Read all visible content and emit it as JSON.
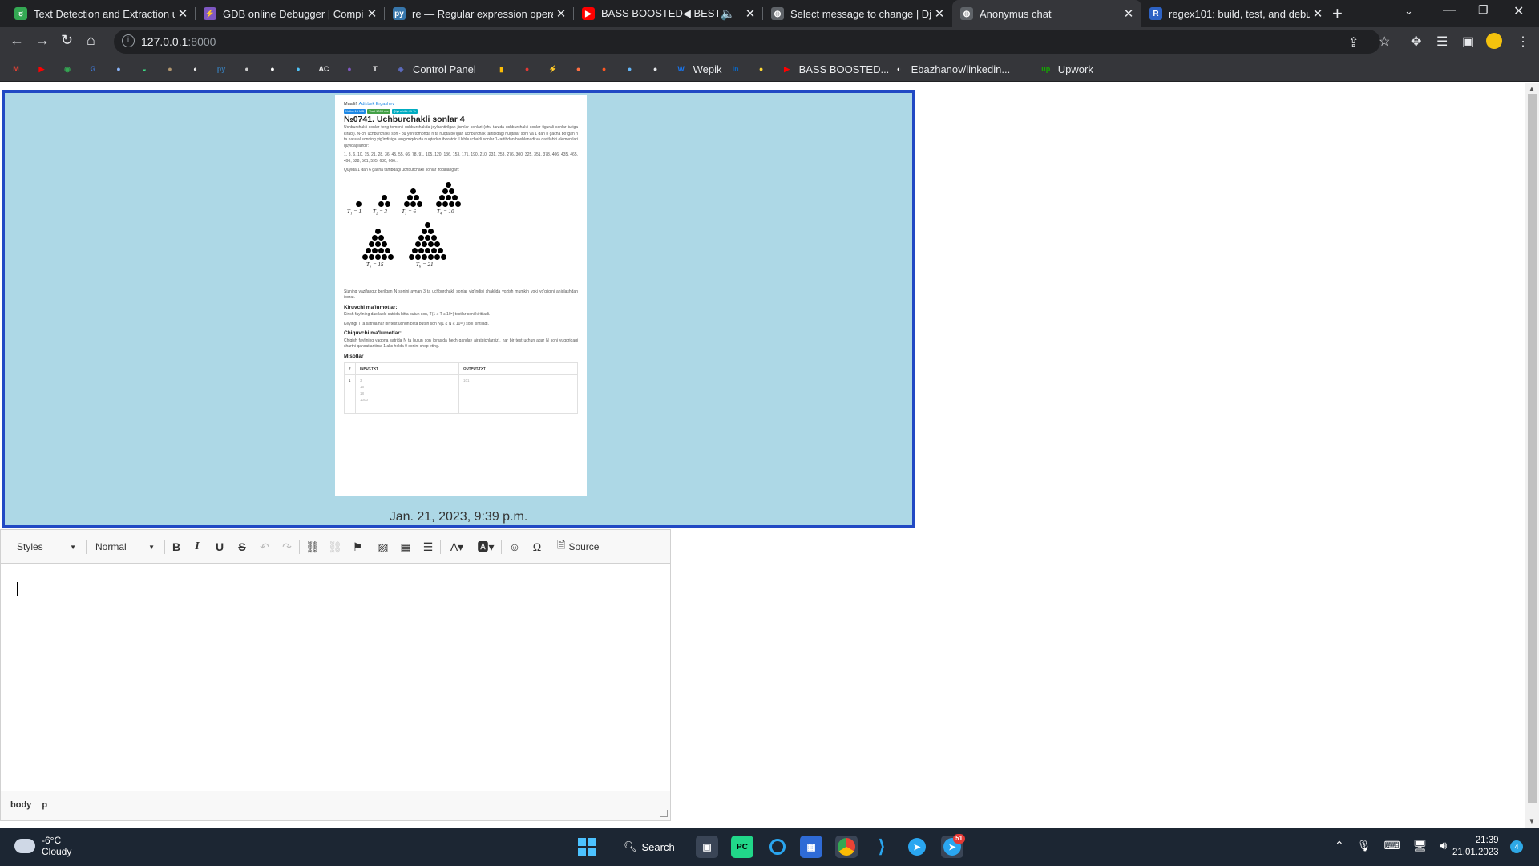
{
  "browser": {
    "tabs": [
      {
        "title": "Text Detection and Extraction us",
        "icon": "ocr-icon",
        "color": "#34a853"
      },
      {
        "title": "GDB online Debugger | Compile",
        "icon": "gdb-icon",
        "color": "#7e57c2"
      },
      {
        "title": "re — Regular expression operati",
        "icon": "python-icon",
        "color": "#3776ab"
      },
      {
        "title": "BASS BOOSTED◀ BEST",
        "icon": "youtube-icon",
        "color": "#ff0000"
      },
      {
        "title": "Select message to change | Djan",
        "icon": "globe-icon",
        "color": "#5f6368"
      },
      {
        "title": "Anonymus chat",
        "icon": "globe-icon",
        "color": "#5f6368"
      },
      {
        "title": "regex101: build, test, and debug",
        "icon": "regex101-icon",
        "color": "#2d62c4"
      }
    ],
    "url_host": "127.0.0.1",
    "url_port": ":8000",
    "bookmarks": [
      {
        "label": "",
        "icon": "gmail-icon",
        "color": "#ea4335"
      },
      {
        "label": "",
        "icon": "youtube-icon",
        "color": "#ff0000"
      },
      {
        "label": "",
        "icon": "maps-icon",
        "color": "#34a853"
      },
      {
        "label": "",
        "icon": "translate-icon",
        "color": "#4285f4"
      },
      {
        "label": "",
        "icon": "bookmark-icon",
        "color": "#8ab4f8"
      },
      {
        "label": "",
        "icon": "android-icon",
        "color": "#3ddc84"
      },
      {
        "label": "",
        "icon": "bookmark-icon",
        "color": "#b0956e"
      },
      {
        "label": "",
        "icon": "github-icon",
        "color": "#ffffff"
      },
      {
        "label": "",
        "icon": "python-icon",
        "color": "#3776ab"
      },
      {
        "label": "",
        "icon": "bookmark-icon",
        "color": "#cccccc"
      },
      {
        "label": "",
        "icon": "bookmark-icon",
        "color": "#ffffff"
      },
      {
        "label": "",
        "icon": "bookmark-icon",
        "color": "#4fc3f7"
      },
      {
        "label": "",
        "icon": "atcoder-icon",
        "color": "#eeeeee"
      },
      {
        "label": "",
        "icon": "bookmark-icon",
        "color": "#7e57c2"
      },
      {
        "label": "",
        "icon": "typora-icon",
        "color": "#ffffff"
      },
      {
        "label": "Control Panel",
        "icon": "control-panel-icon",
        "color": "#5c6bc0"
      },
      {
        "label": "",
        "icon": "chart-icon",
        "color": "#fbbc05"
      },
      {
        "label": "",
        "icon": "bookmark-icon",
        "color": "#e53935"
      },
      {
        "label": "",
        "icon": "gdb-icon",
        "color": "#7e57c2"
      },
      {
        "label": "",
        "icon": "bookmark-icon",
        "color": "#ff7043"
      },
      {
        "label": "",
        "icon": "bookmark-icon",
        "color": "#ff5722"
      },
      {
        "label": "",
        "icon": "bookmark-icon",
        "color": "#64b5f6"
      },
      {
        "label": "",
        "icon": "bookmark-icon",
        "color": "#e8eaed"
      },
      {
        "label": "Wepik",
        "icon": "wepik-icon",
        "color": "#1a73e8"
      },
      {
        "label": "",
        "icon": "linkedin-icon",
        "color": "#0a66c2"
      },
      {
        "label": "",
        "icon": "bookmark-icon",
        "color": "#fdd835"
      },
      {
        "label": "BASS BOOSTED...",
        "icon": "youtube-icon",
        "color": "#ff0000"
      },
      {
        "label": "Ebazhanov/linkedin...",
        "icon": "github-icon",
        "color": "#ffffff"
      },
      {
        "label": "Upwork",
        "icon": "upwork-icon",
        "color": "#14a800"
      }
    ]
  },
  "preview": {
    "author_label": "Muallif:",
    "author_name": "Adizbek Ergashev",
    "badges": [
      {
        "text": "Xotira 16 MB",
        "color": "#1e88e5"
      },
      {
        "text": "Vaqt 1000 ms",
        "color": "#43a047"
      },
      {
        "text": "Qiyinchilik 41 %",
        "color": "#00acc1"
      }
    ],
    "title": "№0741. Uchburchakli sonlar 4",
    "intro": "Uchburchakli sonlar teng tomonli uchburchakda joylashtirilgan jismlar sonlari (shu tarzda uchburchakli sonlar figurali sonlar turiga kiradi). N-chi uchburchakli son - bu yon tomonda n ta nuqta bo'lgan uchburchak tartibidagi nuqtalar soni va 1 dan n gacha bo'lgan n ta natural sonning yig'indisiga teng miqdorda nuqtadan iboratdir. Uchburchakli sonlar 1-tartibdan boshlanadi va dastlabki elementlari quyidagilardir:",
    "sequence": "1, 3, 6, 10, 15, 21, 28, 36, 45, 55, 66, 78, 91, 105, 120, 136, 153, 171, 190, 210, 231, 253, 276, 300, 325, 351, 378, 406, 435, 465, 496, 528, 561, 595, 630, 666...",
    "figure_caption": "Quyida 1 dan 6 gacha tartibdagi uchburchakli sonlar ifodalangan:",
    "triangle_labels": [
      "T₁ = 1",
      "T₂ = 3",
      "T₃ = 6",
      "T₄ = 10",
      "T₅ = 15",
      "T₆ = 21"
    ],
    "task": "Sizning vazifangiz berilgan N sonini aynan 3 ta uchburchakli sonlar yig'indisi shaklida yozish mumkin yoki yo'qligini aniqlashdan iborat.",
    "input_heading": "Kiruvchi ma'lumotlar:",
    "input_line1": "Kirish faylining dastlabki satrida bitta butun son, T(1 ≤ T ≤ 10⁵) testlar soni kiritiladi.",
    "input_line2": "Keyingi T ta satrda har bir test uchun bitta butun son N(1 ≤ N ≤ 10¹⁸) soni kiritiladi.",
    "output_heading": "Chiquvchi ma'lumotlar:",
    "output_line": "Chiqish faylining yagona satrida N ta butun son (orasida hech qanday ajratgichlarsiz), har bir test uchun agar N soni yuqoridagi shartni qanoatlantirsa 1 aks holda 0 sonini chop eting.",
    "examples_heading": "Misollar",
    "table_headers": [
      "#",
      "INPUT.TXT",
      "OUTPUT.TXT"
    ],
    "example_index": "1",
    "example_input": [
      "3",
      "16",
      "18",
      "1000"
    ],
    "example_output": "101",
    "timestamp": "Jan. 21, 2023, 9:39 p.m."
  },
  "editor": {
    "styles_label": "Styles",
    "format_label": "Normal",
    "source_label": "Source",
    "path": [
      "body",
      "p"
    ]
  },
  "taskbar": {
    "temperature": "-6°C",
    "condition": "Cloudy",
    "search_label": "Search",
    "time": "21:39",
    "date": "21.01.2023",
    "telegram_badge": "51",
    "notification_count": "4"
  }
}
